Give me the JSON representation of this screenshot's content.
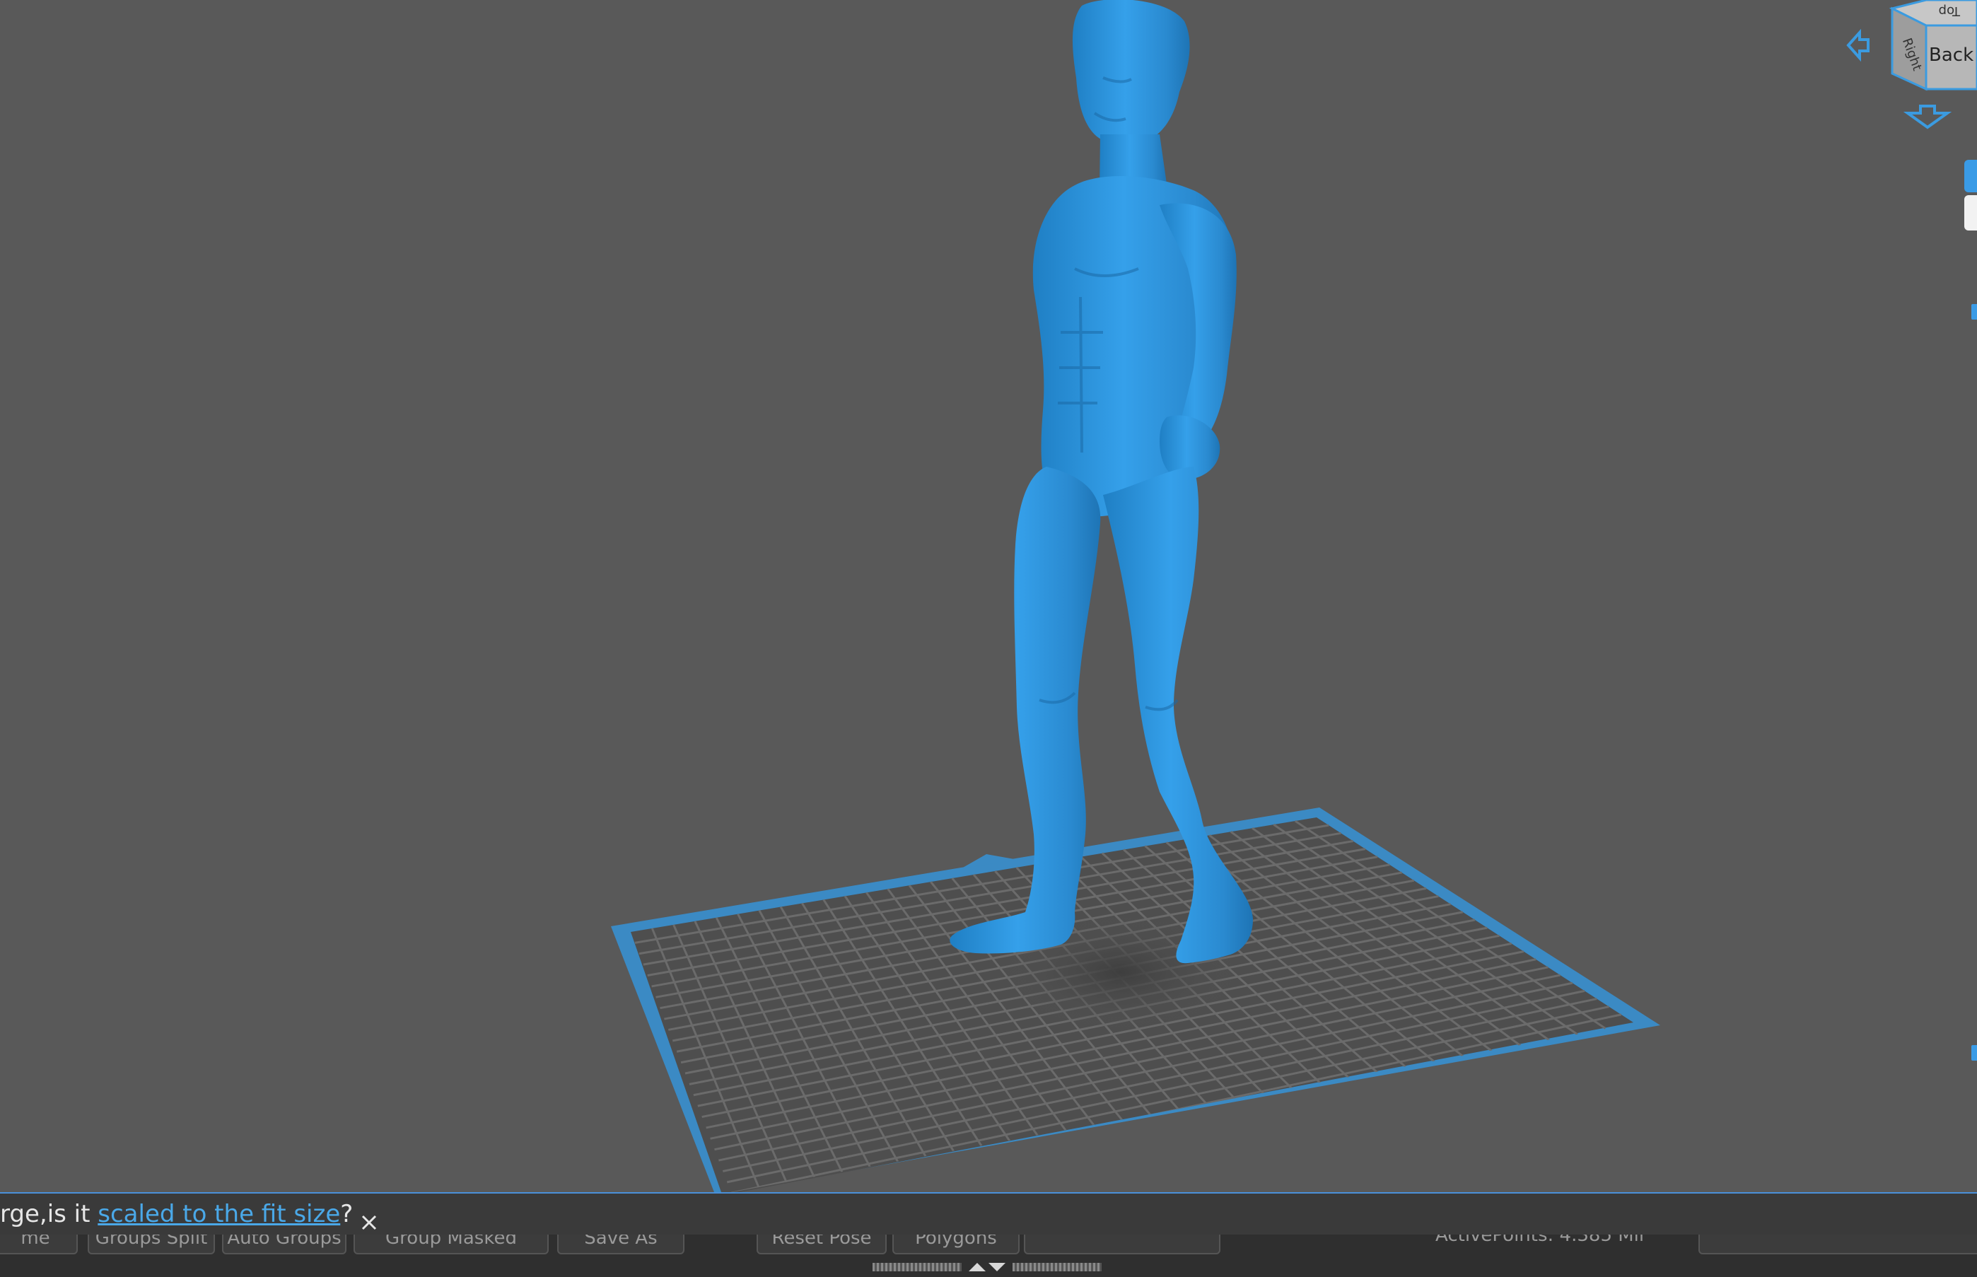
{
  "viewport": {
    "model_name": "human-figure-model",
    "build_plate": "build-plate"
  },
  "nav_cube": {
    "top_label": "Top",
    "right_label": "Right",
    "back_label": "Back"
  },
  "notification": {
    "prefix": "rge,is it ",
    "link_text": "scaled to the fit size",
    "suffix": "?"
  },
  "toolbar": {
    "buttons": [
      "me",
      "Groups Split",
      "Auto Groups",
      "Group Masked",
      "Save As",
      "Reset Pose",
      "Polygons",
      ""
    ],
    "status": "ActivePoints: 4.385 Mil"
  },
  "colors": {
    "model": "#2e93d9",
    "plate_border": "#3b8ac4",
    "accent": "#4aa8e8"
  }
}
